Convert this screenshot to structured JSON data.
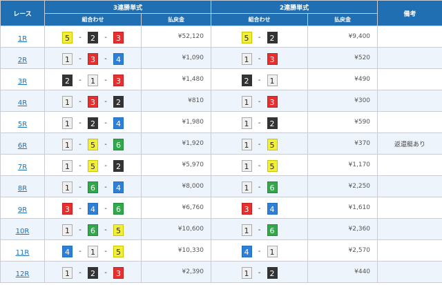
{
  "header": {
    "race": "レース",
    "trifecta": "3連勝単式",
    "exacta": "2連勝単式",
    "note": "備考",
    "combination": "組合わせ",
    "payout": "払戻金"
  },
  "colors": {
    "header_bg": "#1f6fb2",
    "boat_1": "#f0f0f0",
    "boat_2": "#333333",
    "boat_3": "#e63030",
    "boat_4": "#2f7fd9",
    "boat_5": "#f2ee3c",
    "boat_6": "#31a84a"
  },
  "separator": "-",
  "rows": [
    {
      "race": "1R",
      "tri": [
        "5",
        "2",
        "3"
      ],
      "tri_pay": "¥52,120",
      "ex": [
        "5",
        "2"
      ],
      "ex_pay": "¥9,400",
      "note": ""
    },
    {
      "race": "2R",
      "tri": [
        "1",
        "3",
        "4"
      ],
      "tri_pay": "¥1,090",
      "ex": [
        "1",
        "3"
      ],
      "ex_pay": "¥520",
      "note": ""
    },
    {
      "race": "3R",
      "tri": [
        "2",
        "1",
        "3"
      ],
      "tri_pay": "¥1,480",
      "ex": [
        "2",
        "1"
      ],
      "ex_pay": "¥490",
      "note": ""
    },
    {
      "race": "4R",
      "tri": [
        "1",
        "3",
        "2"
      ],
      "tri_pay": "¥810",
      "ex": [
        "1",
        "3"
      ],
      "ex_pay": "¥300",
      "note": ""
    },
    {
      "race": "5R",
      "tri": [
        "1",
        "2",
        "4"
      ],
      "tri_pay": "¥1,980",
      "ex": [
        "1",
        "2"
      ],
      "ex_pay": "¥590",
      "note": ""
    },
    {
      "race": "6R",
      "tri": [
        "1",
        "5",
        "6"
      ],
      "tri_pay": "¥1,920",
      "ex": [
        "1",
        "5"
      ],
      "ex_pay": "¥370",
      "note": "返還艇あり"
    },
    {
      "race": "7R",
      "tri": [
        "1",
        "5",
        "2"
      ],
      "tri_pay": "¥5,970",
      "ex": [
        "1",
        "5"
      ],
      "ex_pay": "¥1,170",
      "note": ""
    },
    {
      "race": "8R",
      "tri": [
        "1",
        "6",
        "4"
      ],
      "tri_pay": "¥8,000",
      "ex": [
        "1",
        "6"
      ],
      "ex_pay": "¥2,250",
      "note": ""
    },
    {
      "race": "9R",
      "tri": [
        "3",
        "4",
        "6"
      ],
      "tri_pay": "¥6,760",
      "ex": [
        "3",
        "4"
      ],
      "ex_pay": "¥1,610",
      "note": ""
    },
    {
      "race": "10R",
      "tri": [
        "1",
        "6",
        "5"
      ],
      "tri_pay": "¥10,600",
      "ex": [
        "1",
        "6"
      ],
      "ex_pay": "¥2,360",
      "note": ""
    },
    {
      "race": "11R",
      "tri": [
        "4",
        "1",
        "5"
      ],
      "tri_pay": "¥10,330",
      "ex": [
        "4",
        "1"
      ],
      "ex_pay": "¥2,570",
      "note": ""
    },
    {
      "race": "12R",
      "tri": [
        "1",
        "2",
        "3"
      ],
      "tri_pay": "¥2,390",
      "ex": [
        "1",
        "2"
      ],
      "ex_pay": "¥440",
      "note": ""
    }
  ]
}
